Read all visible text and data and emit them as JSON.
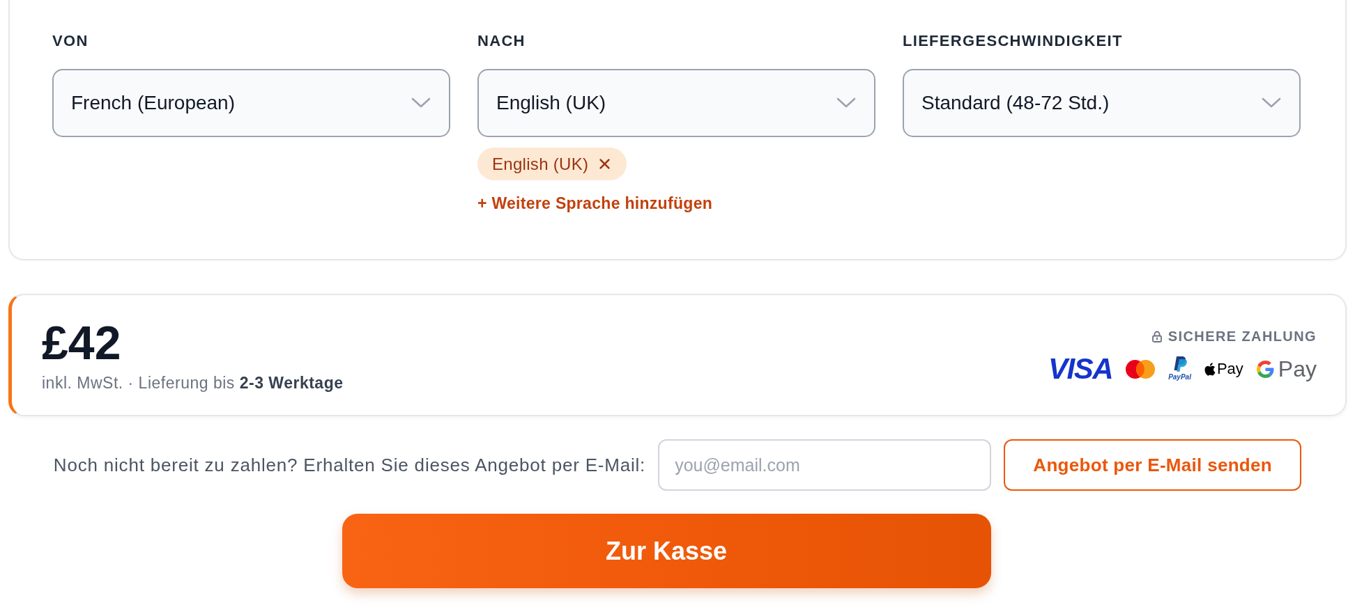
{
  "fields": [
    {
      "label": "VON",
      "value": "French (European)"
    },
    {
      "label": "NACH",
      "value": "English (UK)",
      "tags": [
        {
          "label": "English (UK)"
        }
      ],
      "add_link": "+ Weitere Sprache hinzufügen"
    },
    {
      "label": "LIEFERGESCHWINDIGKEIT",
      "value": "Standard (48-72 Std.)"
    }
  ],
  "price": {
    "amount": "£42",
    "note": "inkl. MwSt. · Lieferung bis **2-3 Werktage**"
  },
  "secure_payment": {
    "label": "SICHERE ZAHLUNG",
    "methods": [
      {
        "kind": "visa",
        "label": "VISA"
      },
      {
        "kind": "mastercard"
      },
      {
        "kind": "paypal",
        "label": "PayPal"
      },
      {
        "kind": "apple_pay",
        "label": "Pay"
      },
      {
        "kind": "google_pay",
        "label": "Pay"
      }
    ]
  },
  "email_offer": {
    "prompt": "Noch nicht bereit zu zahlen? Erhalten Sie dieses Angebot per E-Mail:",
    "placeholder": "you@email.com",
    "button": "Angebot per E-Mail senden"
  },
  "checkout_button": "Zur Kasse"
}
